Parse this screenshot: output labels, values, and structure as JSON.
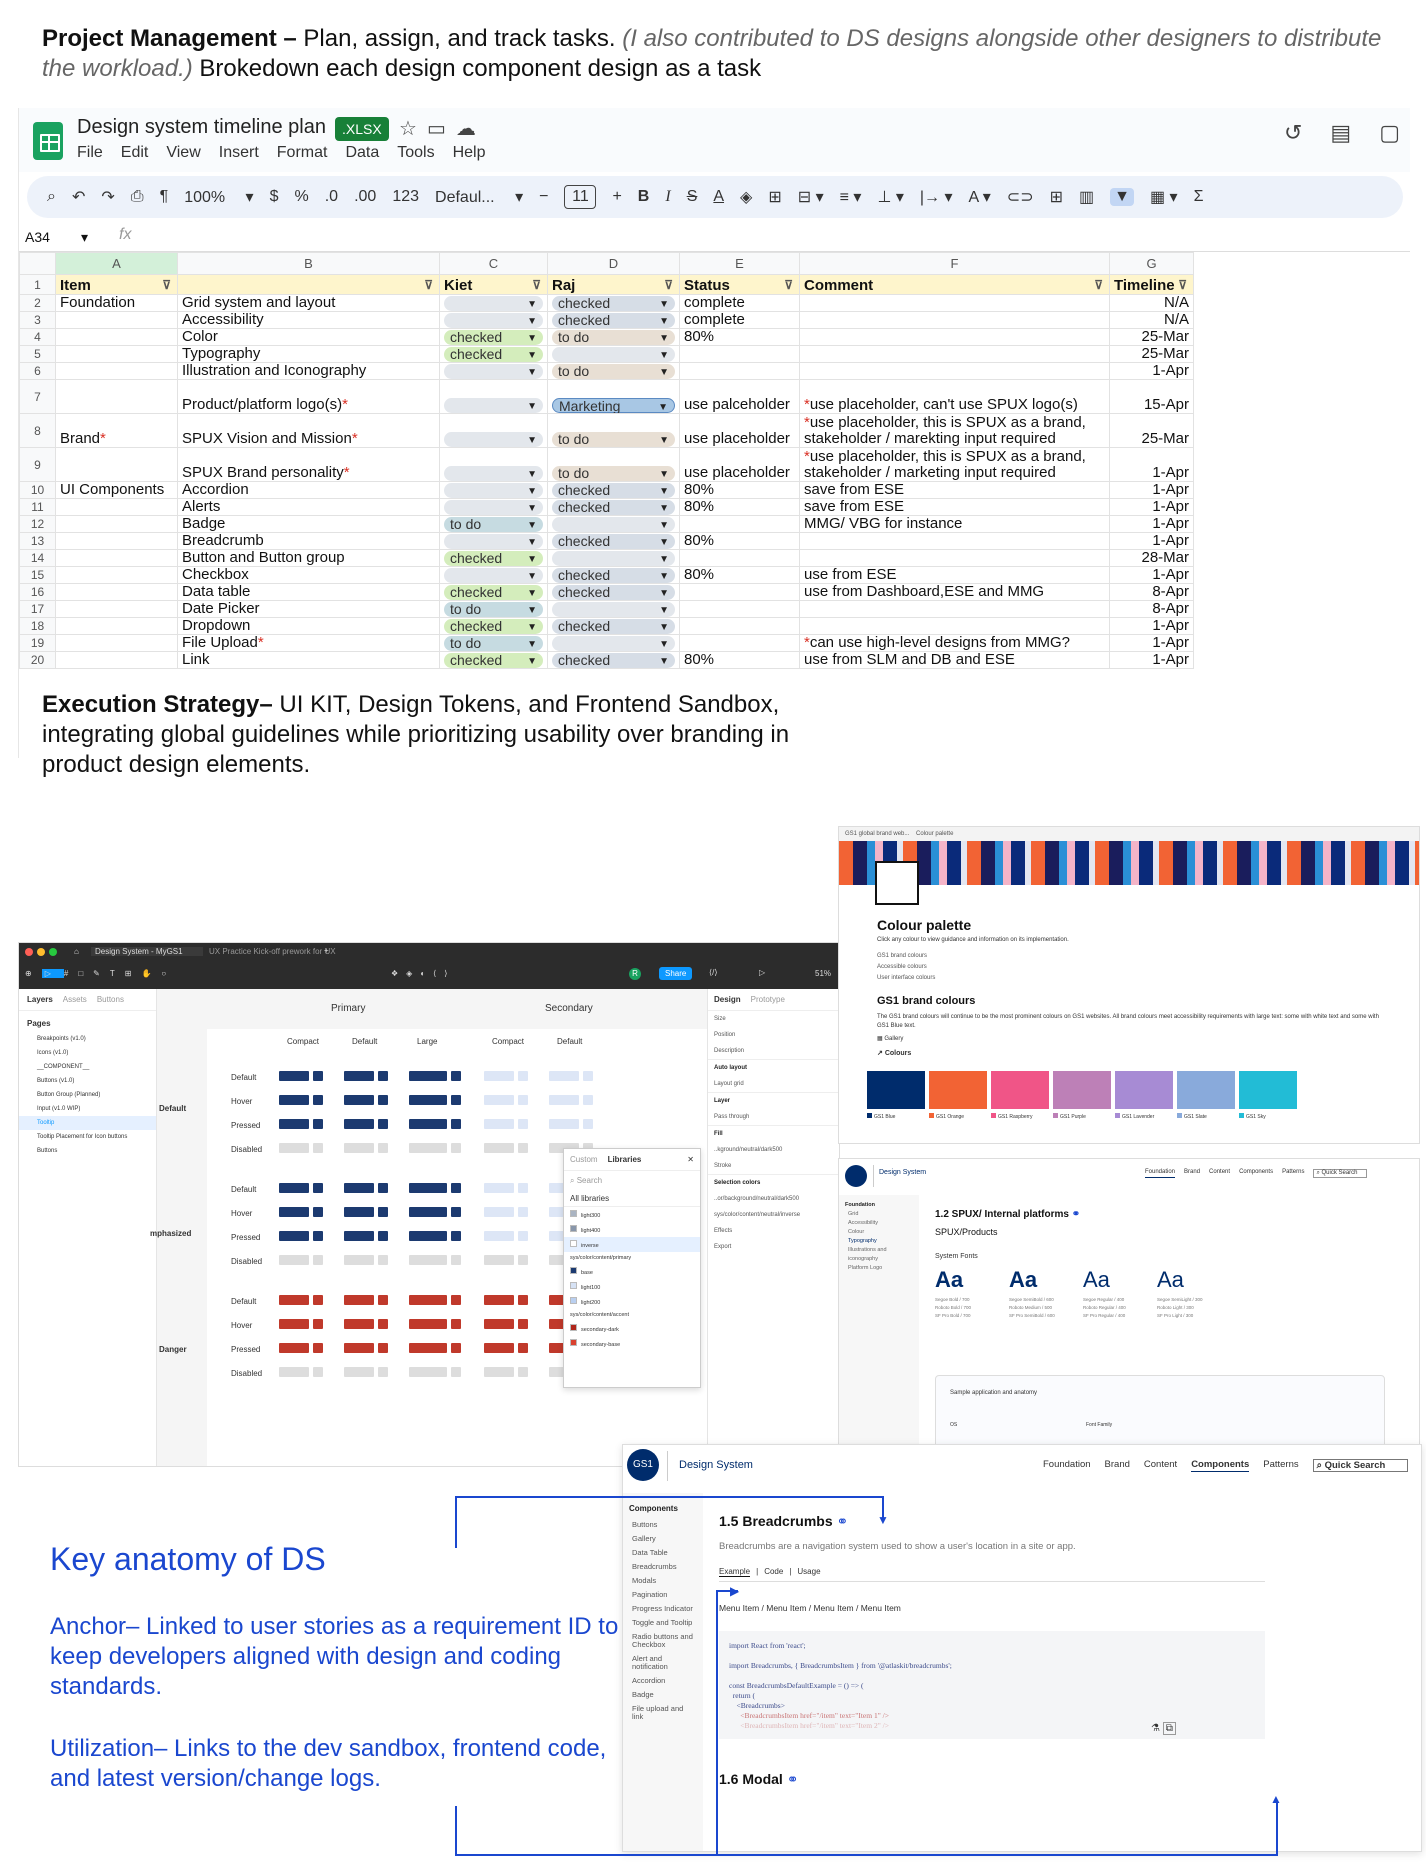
{
  "intro": {
    "heading": "Project Management –",
    "text1": " Plan, assign, and track tasks. ",
    "italic": "(I also contributed to DS designs alongside other designers to distribute the workload.)",
    "text2": " Brokedown each design component design as a task"
  },
  "sheet": {
    "title": "Design system timeline plan",
    "badge": ".XLSX",
    "menu": [
      "File",
      "Edit",
      "View",
      "Insert",
      "Format",
      "Data",
      "Tools",
      "Help"
    ],
    "toolbar": {
      "zoom": "100%",
      "currency": "$",
      "percent": "%",
      "dec_dec": ".0",
      "dec_inc": ".00",
      "num": "123",
      "font": "Defaul...",
      "size": "11"
    },
    "cell_ref": "A34",
    "fx": "fx",
    "col_letters": [
      "A",
      "B",
      "C",
      "D",
      "E",
      "F",
      "G"
    ],
    "headers": [
      "Item",
      "",
      "Kiet",
      "Raj",
      "Status",
      "Comment",
      "Timeline"
    ],
    "rows": [
      {
        "n": "2",
        "a": "Foundation",
        "b": "Grid system and layout",
        "c": "",
        "d": "checked",
        "e": "complete",
        "f": "",
        "g": "N/A"
      },
      {
        "n": "3",
        "a": "",
        "b": "Accessibility",
        "c": "",
        "d": "checked",
        "e": "complete",
        "f": "",
        "g": "N/A"
      },
      {
        "n": "4",
        "a": "",
        "b": "Color",
        "c": "checked",
        "d": "to do",
        "e": "80%",
        "f": "",
        "g": "25-Mar"
      },
      {
        "n": "5",
        "a": "",
        "b": "Typography",
        "c": "checked",
        "d": "",
        "e": "",
        "f": "",
        "g": "25-Mar"
      },
      {
        "n": "6",
        "a": "",
        "b": "Illustration and Iconography",
        "c": "",
        "d": "to do",
        "e": "",
        "f": "",
        "g": "1-Apr"
      },
      {
        "n": "7",
        "a": "",
        "b": "Product/platform logo(s)*",
        "c": "",
        "d": "Marketing",
        "e": "use palceholder",
        "f": "*use placeholder, can't use SPUX logo(s)",
        "g": "15-Apr"
      },
      {
        "n": "8",
        "a": "Brand*",
        "b": "SPUX Vision and Mission*",
        "c": "",
        "d": "to do",
        "e": "use placeholder",
        "f": "*use placeholder, this is SPUX as a brand, stakeholder / marekting input required",
        "g": "25-Mar"
      },
      {
        "n": "9",
        "a": "",
        "b": "SPUX Brand personality*",
        "c": "",
        "d": "to do",
        "e": "use placeholder",
        "f": "*use placeholder, this is SPUX as a brand, stakeholder / marketing input required",
        "g": "1-Apr"
      },
      {
        "n": "10",
        "a": "UI Components",
        "b": "Accordion",
        "c": "",
        "d": "checked",
        "e": "80%",
        "f": "save from ESE",
        "g": "1-Apr"
      },
      {
        "n": "11",
        "a": "",
        "b": "Alerts",
        "c": "",
        "d": "checked",
        "e": "80%",
        "f": "save from ESE",
        "g": "1-Apr"
      },
      {
        "n": "12",
        "a": "",
        "b": "Badge",
        "c": "to do",
        "d": "",
        "e": "",
        "f": "MMG/ VBG for instance",
        "g": "1-Apr"
      },
      {
        "n": "13",
        "a": "",
        "b": "Breadcrumb",
        "c": "",
        "d": "checked",
        "e": "80%",
        "f": "",
        "g": "1-Apr"
      },
      {
        "n": "14",
        "a": "",
        "b": "Button and Button group",
        "c": "checked",
        "d": "",
        "e": "",
        "f": "",
        "g": "28-Mar"
      },
      {
        "n": "15",
        "a": "",
        "b": "Checkbox",
        "c": "",
        "d": "checked",
        "e": "80%",
        "f": "use from ESE",
        "g": "1-Apr"
      },
      {
        "n": "16",
        "a": "",
        "b": "Data table",
        "c": "checked",
        "d": "checked",
        "e": "",
        "f": "use from Dashboard,ESE and MMG",
        "g": "8-Apr"
      },
      {
        "n": "17",
        "a": "",
        "b": "Date Picker",
        "c": "to do",
        "d": "",
        "e": "",
        "f": "",
        "g": "8-Apr"
      },
      {
        "n": "18",
        "a": "",
        "b": "Dropdown",
        "c": "checked",
        "d": "checked",
        "e": "",
        "f": "",
        "g": "1-Apr"
      },
      {
        "n": "19",
        "a": "",
        "b": "File Upload*",
        "c": "to do",
        "d": "",
        "e": "",
        "f": "*can use high-level designs from MMG?",
        "g": "1-Apr"
      },
      {
        "n": "20",
        "a": "",
        "b": "Link",
        "c": "checked",
        "d": "checked",
        "e": "80%",
        "f": "use from SLM and DB and ESE",
        "g": "1-Apr"
      }
    ]
  },
  "exec": {
    "heading": "Execution Strategy–",
    "text": " UI KIT, Design Tokens, and Frontend Sandbox, integrating global guidelines while prioritizing usability over branding in product design elements."
  },
  "figma": {
    "tab1": "Design System - MyGS1",
    "tab2": "UX Practice Kick-off prework for UX",
    "share": "Share",
    "zoom": "51%",
    "left_tabs": [
      "Layers",
      "Assets",
      "Buttons"
    ],
    "pages_label": "Pages",
    "pages": [
      "Breakpoints (v1.0)",
      "Icons (v1.0)",
      "__COMPONENT__",
      "Buttons (v1.0)",
      "Button Group (Planned)",
      "Input (v1.0 WIP)",
      "Tooltip",
      "Tooltip Placement for Icon buttons",
      "Buttons"
    ],
    "col_primary": "Primary",
    "col_secondary": "Secondary",
    "sizes": [
      "Compact",
      "Default",
      "Large",
      "Compact",
      "Default"
    ],
    "groups": [
      "Default",
      "mphasized",
      "Danger"
    ],
    "states": [
      "Default",
      "Hover",
      "Pressed",
      "Disabled"
    ],
    "lib_tabs": [
      "Custom",
      "Libraries"
    ],
    "lib_search": "Search",
    "lib_all": "All libraries",
    "lib_items": [
      "light300",
      "light400",
      "inverse",
      "sys/color/content/primary",
      "base",
      "light100",
      "light200",
      "sys/color/content/accent",
      "secondary-dark",
      "secondary-base"
    ],
    "right_tabs": [
      "Design",
      "Prototype"
    ],
    "right_labels": [
      "Size",
      "Position",
      "Description",
      "Auto layout",
      "Layout grid",
      "Layer",
      "Pass through",
      "Fill",
      "..kground/neutral/dark500",
      "Stroke",
      "Selection colors",
      "..or/background/neutral/dark500",
      "sys/color/content/neutral/inverse",
      "Effects",
      "Export"
    ],
    "right_values": [
      "Default",
      "None",
      "Tooltip Description",
      "100%"
    ]
  },
  "palette": {
    "tab": "GS1 global brand web...",
    "tab2": "Colour palette",
    "title": "Colour palette",
    "desc": "Click any colour to view guidance and information on its implementation.",
    "links": [
      "GS1 brand colours",
      "Accessible colours",
      "User interface colours"
    ],
    "section": "GS1 brand colours",
    "section_desc": "The GS1 brand colours will continue to be the most prominent colours on GS1 websites. All brand colours meet accessibility requirements with large text: some with white text and some with GS1 Blue text.",
    "gallery": "Gallery",
    "colours_label": "Colours",
    "swatches": [
      {
        "name": "GS1 Blue",
        "color": "#002c6c"
      },
      {
        "name": "GS1 Orange",
        "color": "#f26334"
      },
      {
        "name": "GS1 Raspberry",
        "color": "#f05587"
      },
      {
        "name": "GS1 Purple",
        "color": "#bd80b7"
      },
      {
        "name": "GS1 Lavender",
        "color": "#a78bd4"
      },
      {
        "name": "GS1 Slate",
        "color": "#89aadb"
      },
      {
        "name": "GS1 Sky",
        "color": "#22bcd6"
      }
    ]
  },
  "typo": {
    "brand": "Design System",
    "nav": [
      "Foundation",
      "Brand",
      "Content",
      "Components",
      "Patterns"
    ],
    "search": "Quick Search",
    "side": [
      "Foundation",
      "Grid",
      "Accessibility",
      "Colour",
      "Typography",
      "Illustrations and iconography",
      "Platform Logo"
    ],
    "title": "1.2 SPUX/ Internal platforms",
    "subtitle": "SPUX/Products",
    "fonts_label": "System Fonts",
    "samples": [
      {
        "aa": "Aa",
        "l1": "Segoe Bold / 700",
        "l2": "Roboto Bold / 700",
        "l3": "SF Pro Bold / 700"
      },
      {
        "aa": "Aa",
        "l1": "Segoe SemiBold / 600",
        "l2": "Roboto Medium / 500",
        "l3": "SF Pro SemiBold / 600"
      },
      {
        "aa": "Aa",
        "l1": "Segoe Regular / 400",
        "l2": "Roboto Regular / 400",
        "l3": "SF Pro Regular / 400"
      },
      {
        "aa": "Aa",
        "l1": "Segoe SemiLight / 300",
        "l2": "Roboto Light / 300",
        "l3": "SF Pro Light / 300"
      }
    ],
    "card_title": "Sample application and anatomy",
    "card_c1": "OS",
    "card_c2": "Font Family"
  },
  "crumbs": {
    "brand": "Design System",
    "nav": [
      "Foundation",
      "Brand",
      "Content",
      "Components",
      "Patterns"
    ],
    "search": "Quick Search",
    "side_title": "Components",
    "side": [
      "Buttons",
      "Gallery",
      "Data Table",
      "Breadcrumbs",
      "Modals",
      "Pagination",
      "Progress Indicator",
      "Toggle and Tooltip",
      "Radio buttons and Checkbox",
      "Alert and notification",
      "Accordion",
      "Badge",
      "File upload and link"
    ],
    "title": "1.5 Breadcrumbs",
    "desc": "Breadcrumbs are a navigation system used to show a user's location in a site or app.",
    "tabs": [
      "Example",
      "Code",
      "Usage"
    ],
    "example": "Menu Item  / Menu Item  / Menu Item  / Menu Item",
    "code": [
      "import React from 'react';",
      "import Breadcrumbs, { BreadcrumbsItem } from '@atlaskit/breadcrumbs';",
      "const BreadcrumbsDefaultExample = () => (",
      "  return (",
      "    <Breadcrumbs>",
      "      <BreadcrumbsItem href=\"/item\" text=\"Item 1\" />",
      "      <BreadcrumbsItem href=\"/item\" text=\"Item 2\" />"
    ],
    "next": "1.6 Modal"
  },
  "anatomy": {
    "title": "Key anatomy of DS",
    "p1": "Anchor– Linked to user stories as a requirement ID to keep developers aligned with design and coding standards.",
    "p2": "Utilization– Links to the dev sandbox, frontend code, and latest version/change logs."
  }
}
